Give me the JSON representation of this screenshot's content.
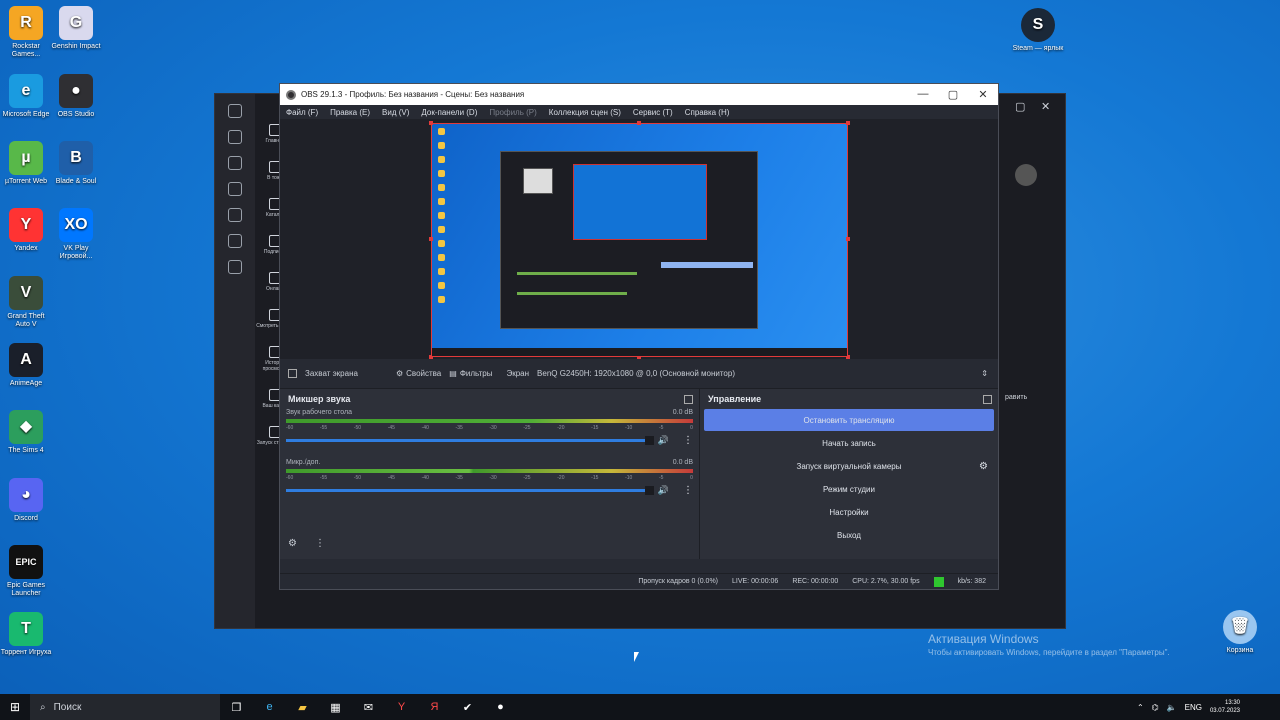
{
  "desktop": {
    "icons": [
      {
        "label": "Rockstar Games...",
        "color": "#f5a623",
        "glyph": "R"
      },
      {
        "label": "Genshin Impact",
        "color": "#d9d9ee",
        "glyph": "G"
      },
      {
        "label": "Microsoft Edge",
        "color": "#1a9be0",
        "glyph": "e"
      },
      {
        "label": "OBS Studio",
        "color": "#2f2f33",
        "glyph": "●"
      },
      {
        "label": "µTorrent Web",
        "color": "#58b849",
        "glyph": "µ"
      },
      {
        "label": "Blade & Soul",
        "color": "#1f5fa9",
        "glyph": "B"
      },
      {
        "label": "Yandex",
        "color": "#ff3333",
        "glyph": "Y"
      },
      {
        "label": "VK Play Игровой...",
        "color": "#0077ff",
        "glyph": "XO"
      },
      {
        "label": "Grand Theft Auto V",
        "color": "#3a4d3a",
        "glyph": "V"
      },
      {
        "label": "AnimeAge",
        "color": "#1a1f2a",
        "glyph": "A"
      },
      {
        "label": "The Sims 4",
        "color": "#2c9e5d",
        "glyph": "◆"
      },
      {
        "label": "Discord",
        "color": "#5865f2",
        "glyph": "◕"
      },
      {
        "label": "Epic Games Launcher",
        "color": "#111111",
        "glyph": "EPIC"
      },
      {
        "label": "Торрент Игруха",
        "color": "#19b96f",
        "glyph": "T"
      }
    ],
    "right_icons": [
      {
        "label": "Steam — ярлык",
        "color": "#1b2838",
        "glyph": "S"
      },
      {
        "label": "Корзина",
        "color": "#9ac6f0",
        "glyph": "🗑"
      }
    ],
    "watermark_title": "Активация Windows",
    "watermark_text": "Чтобы активировать Windows, перейдите в раздел \"Параметры\"."
  },
  "obs": {
    "title": "OBS 29.1.3 - Профиль: Без названия - Сцены: Без названия",
    "menu": [
      {
        "label": "Файл (F)",
        "disabled": false
      },
      {
        "label": "Правка (E)",
        "disabled": false
      },
      {
        "label": "Вид (V)",
        "disabled": false
      },
      {
        "label": "Док-панели (D)",
        "disabled": false
      },
      {
        "label": "Профиль (P)",
        "disabled": true
      },
      {
        "label": "Коллекция сцен (S)",
        "disabled": false
      },
      {
        "label": "Сервис (T)",
        "disabled": false
      },
      {
        "label": "Справка (H)",
        "disabled": false
      }
    ],
    "source_bar": {
      "capture_label": "Захват экрана",
      "properties": "Свойства",
      "filters": "Фильтры",
      "screen_label": "Экран",
      "screen_value": "BenQ G2450H: 1920x1080 @ 0,0 (Основной монитор)"
    },
    "mixer": {
      "title": "Микшер звука",
      "channels": [
        {
          "name": "Звук рабочего стола",
          "db": "0.0 dB"
        },
        {
          "name": "Микр./доп.",
          "db": "0.0 dB"
        }
      ],
      "ticks": [
        "-60",
        "-55",
        "-50",
        "-45",
        "-40",
        "-35",
        "-30",
        "-25",
        "-20",
        "-15",
        "-10",
        "-5",
        "0"
      ]
    },
    "controls": {
      "title": "Управление",
      "buttons": [
        {
          "label": "Остановить трансляцию",
          "primary": true
        },
        {
          "label": "Начать запись",
          "primary": false
        },
        {
          "label": "Запуск виртуальной камеры",
          "primary": false
        },
        {
          "label": "Режим студии",
          "primary": false
        },
        {
          "label": "Настройки",
          "primary": false
        },
        {
          "label": "Выход",
          "primary": false
        }
      ]
    },
    "status": {
      "dropped": "Пропуск кадров 0 (0.0%)",
      "live": "LIVE: 00:00:06",
      "rec": "REC: 00:00:00",
      "cpu": "CPU: 2.7%, 30.00 fps",
      "kbps": "kb/s: 382"
    }
  },
  "browser_bg": {
    "sidebar_labels": [
      "Главная",
      "В тоже",
      "Каталог",
      "Подписки",
      "Oнлайн",
      "Смотреть позже",
      "История просмотра",
      "Ваш канал",
      "Запуск стримов"
    ],
    "right_text": "равить"
  },
  "taskbar": {
    "search_placeholder": "Поиск",
    "lang": "ENG",
    "time": "13:30",
    "date": "03.07.2023"
  }
}
